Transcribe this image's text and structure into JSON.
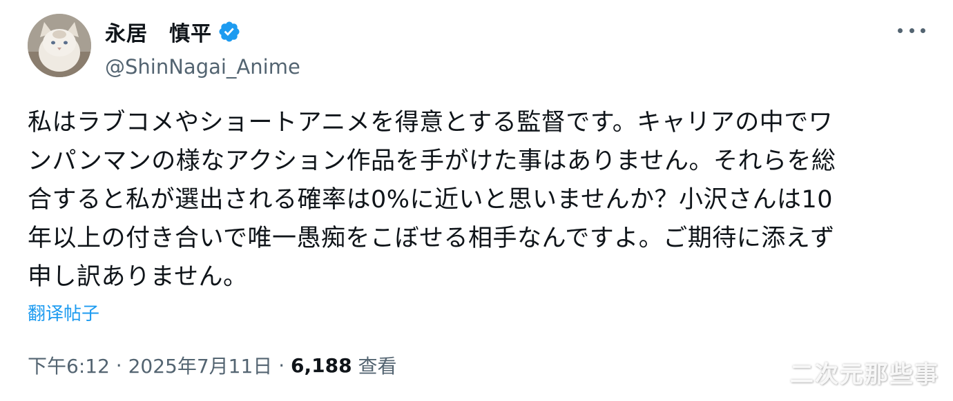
{
  "author": {
    "display_name": "永居　慎平",
    "handle": "@ShinNagai_Anime",
    "verified": true,
    "avatar_icon": "cat-avatar"
  },
  "more_icon": "more-horizontal-icon",
  "tweet": {
    "lines": [
      "私はラブコメやショートアニメを得意とする監督です。キャリアの中でワ",
      "ンパンマンの様なアクション作品を手がけた事はありません。それらを総",
      "合すると私が選出される確率は0%に近いと思いませんか？小沢さんは10",
      "年以上の付き合いで唯一愚痴をこぼせる相手なんですよ。ご期待に添えず",
      "申し訳ありません。"
    ]
  },
  "translate_label": "翻译帖子",
  "meta": {
    "time": "下午6:12",
    "separator": " · ",
    "date": "2025年7月11日",
    "views_count": "6,188",
    "views_label": " 查看"
  },
  "watermark": "二次元那些事",
  "colors": {
    "text_primary": "#0f1419",
    "text_secondary": "#536471",
    "link": "#1d9bf0",
    "verified": "#1d9bf0"
  }
}
